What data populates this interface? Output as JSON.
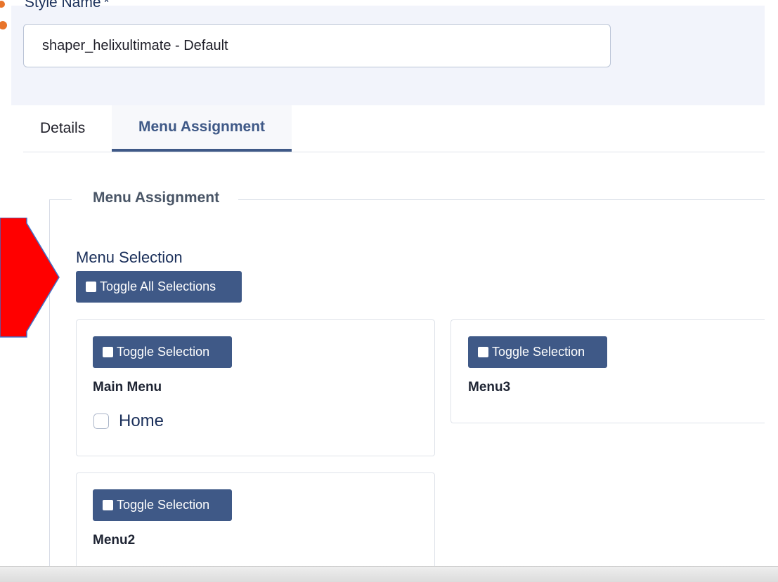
{
  "style_name": {
    "label": "Style Name",
    "required_marker": "*",
    "value": "shaper_helixultimate - Default"
  },
  "tabs": [
    {
      "label": "Details",
      "active": false
    },
    {
      "label": "Menu Assignment",
      "active": true
    }
  ],
  "fieldset": {
    "legend": "Menu Assignment",
    "menu_selection_label": "Menu Selection",
    "toggle_all_label": "Toggle All Selections"
  },
  "menus": [
    {
      "toggle_label": "Toggle Selection",
      "title": "Main Menu",
      "items": [
        {
          "label": "Home",
          "checked": false
        }
      ]
    },
    {
      "toggle_label": "Toggle Selection",
      "title": "Menu3",
      "items": []
    },
    {
      "toggle_label": "Toggle Selection",
      "title": "Menu2",
      "items": []
    }
  ],
  "colors": {
    "accent": "#3f5987",
    "annotation_arrow": "#ff0000",
    "annotation_dots": "#e8742a"
  },
  "icons": {
    "toggle_icon": "white-square-icon",
    "annotation": "red-arrow-icon"
  }
}
